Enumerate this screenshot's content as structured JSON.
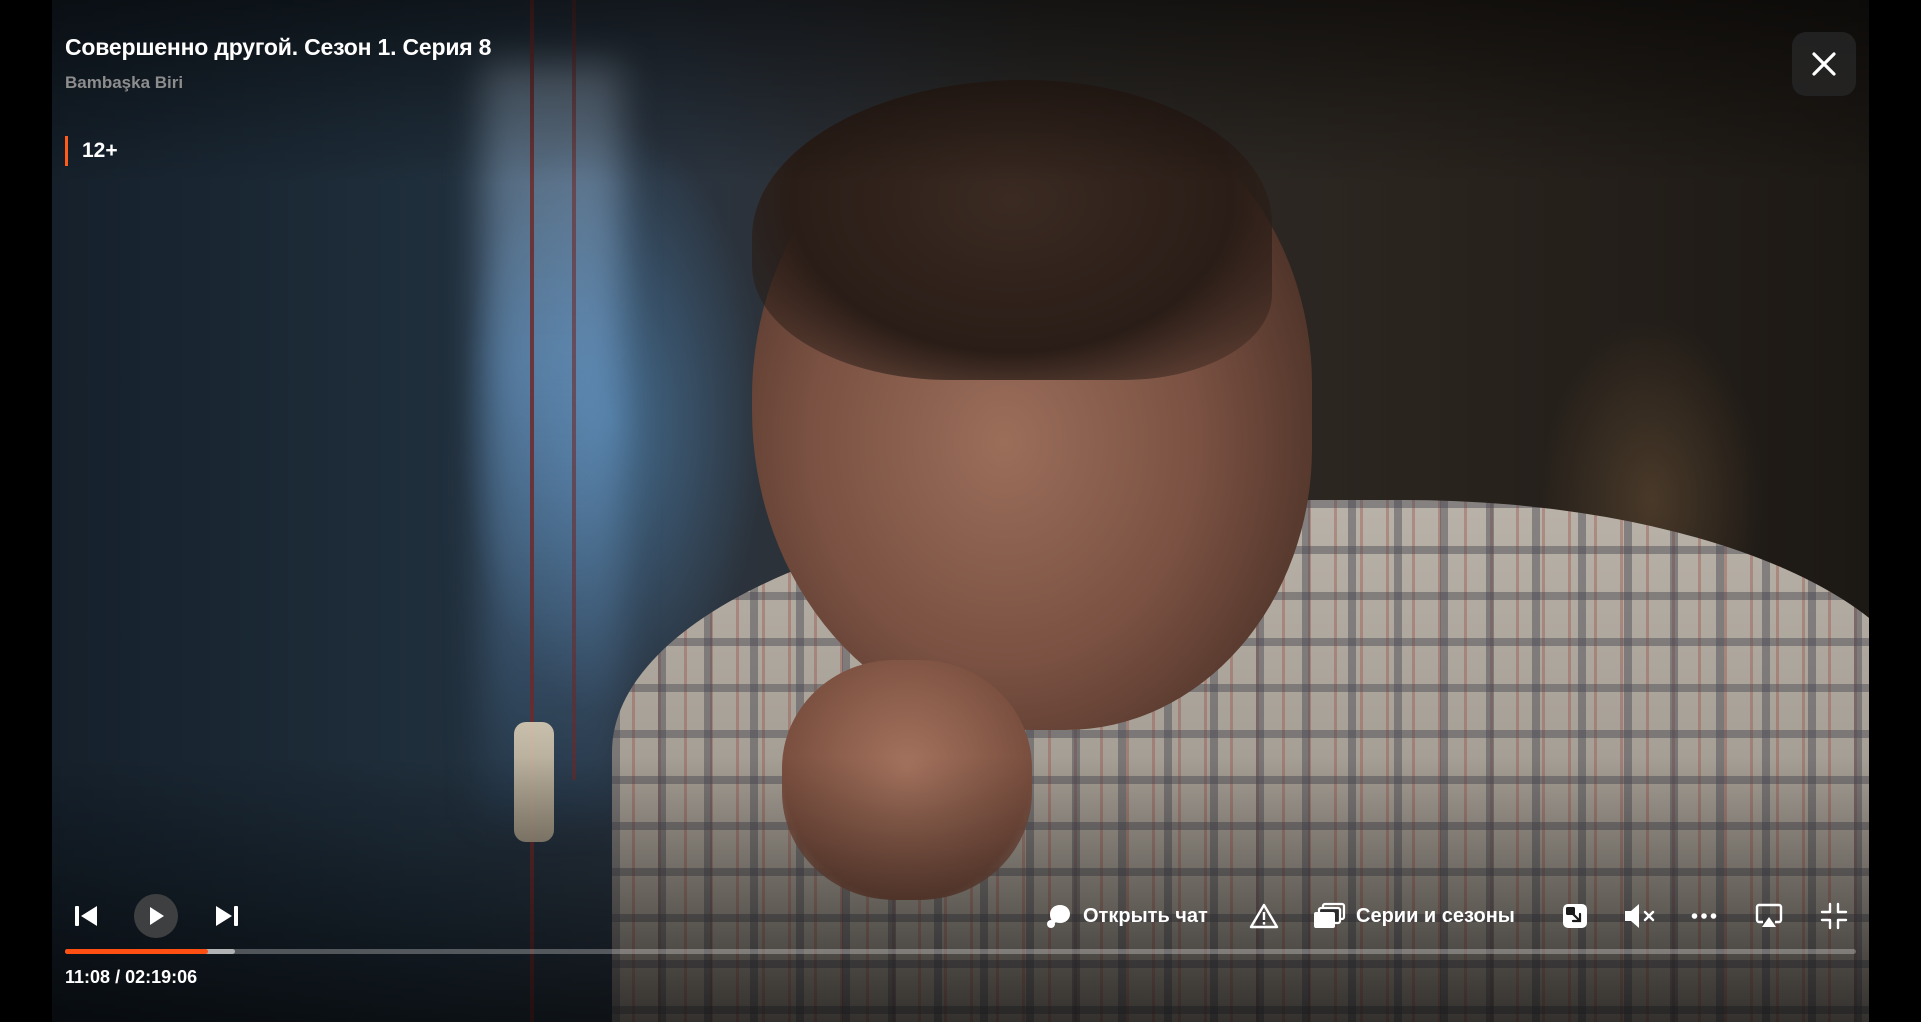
{
  "header": {
    "title": "Совершенно другой. Сезон 1. Серия 8",
    "subtitle": "Bambaşka Biri",
    "age_rating": "12+"
  },
  "controls": {
    "open_chat_label": "Открыть чат",
    "episodes_label": "Серии и сезоны",
    "icons": [
      "previous-icon",
      "play-icon",
      "next-icon",
      "chat-icon",
      "report-warning-icon",
      "episodes-icon",
      "picture-in-picture-icon",
      "volume-muted-icon",
      "more-options-icon",
      "airplay-icon",
      "exit-fullscreen-icon",
      "close-icon"
    ]
  },
  "playback": {
    "current_time": "11:08",
    "separator": "/",
    "duration": "02:19:06",
    "progress_fraction": 0.08,
    "buffered_fraction": 0.095,
    "is_playing": false,
    "is_muted": true
  },
  "colors": {
    "accent": "#ff4f12",
    "rating_bar": "#ff5c1a",
    "subtitle_gray": "#8d8d8d"
  }
}
